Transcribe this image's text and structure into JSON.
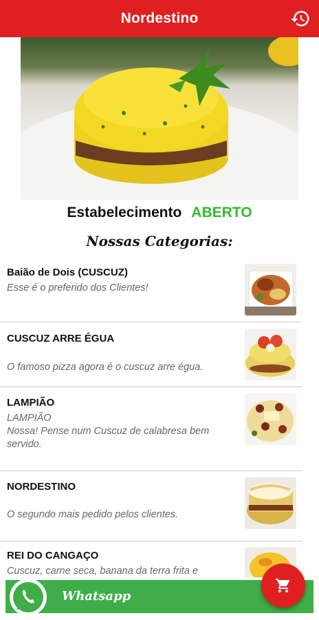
{
  "app": {
    "title": "Nordestino",
    "history_icon": "history-icon"
  },
  "status": {
    "label": "Estabelecimento",
    "value": "ABERTO",
    "value_color": "#33bb2f"
  },
  "section_title": "Nossas Categorias:",
  "categories": [
    {
      "name": "Baião de Dois (CUSCUZ)",
      "description": "Esse é o preferido dos Clientes!"
    },
    {
      "name": "CUSCUZ ARRE ÉGUA",
      "description": "O famoso pizza agora é o cuscuz arre égua."
    },
    {
      "name": "LAMPIÃO",
      "subtitle": "LAMPIÃO",
      "description": "Nossa! Pense num Cuscuz de calabresa bem servido."
    },
    {
      "name": "NORDESTINO",
      "description": "O segundo mais pedido pelos clientes."
    },
    {
      "name": "REI DO CANGAÇO",
      "description": "Cuscuz, carne seca, banana da terra frita e"
    }
  ],
  "whatsapp": {
    "label": "Whatsapp",
    "icon": "whatsapp-icon"
  },
  "cart_icon": "cart-icon",
  "colors": {
    "primary": "#e02020",
    "whatsapp_green": "#3fae49"
  }
}
